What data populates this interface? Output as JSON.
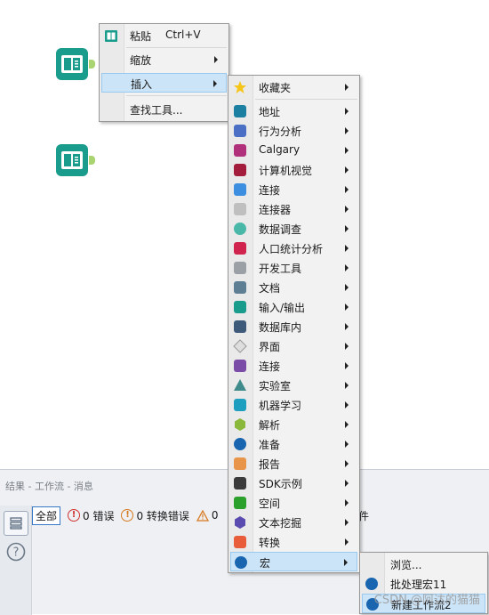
{
  "results": {
    "title": "结果 - 工作流 - 消息",
    "filter_all": "全部",
    "errors": "0 错误",
    "conversion_errors": "0 转换错误",
    "warnings_partial": "0",
    "trailing_char": "件"
  },
  "context_menu": {
    "paste": "粘贴",
    "paste_shortcut": "Ctrl+V",
    "zoom": "缩放",
    "insert": "插入",
    "find_tool": "查找工具..."
  },
  "insert_menu": {
    "items": [
      {
        "label": "收藏夹",
        "icon": "star-icon",
        "color": "#f5c518"
      },
      {
        "label": "地址",
        "icon": "address-icon",
        "color": "#1a7fa0"
      },
      {
        "label": "行为分析",
        "icon": "behavior-analysis-icon",
        "color": "#4a6fc4"
      },
      {
        "label": "Calgary",
        "icon": "calgary-icon",
        "color": "#b0307c"
      },
      {
        "label": "计算机视觉",
        "icon": "computer-vision-icon",
        "color": "#a31c3c"
      },
      {
        "label": "连接",
        "icon": "connector-icon",
        "color": "#3b8ee0"
      },
      {
        "label": "连接器",
        "icon": "connectors-icon",
        "color": "#bfbfbf"
      },
      {
        "label": "数据调查",
        "icon": "data-investigation-icon",
        "color": "#4ab8a8"
      },
      {
        "label": "人口统计分析",
        "icon": "demographic-analysis-icon",
        "color": "#d0244e"
      },
      {
        "label": "开发工具",
        "icon": "developer-icon",
        "color": "#9aa0a6"
      },
      {
        "label": "文档",
        "icon": "documentation-icon",
        "color": "#5e7e94"
      },
      {
        "label": "输入/输出",
        "icon": "in-out-icon",
        "color": "#1a9c8c"
      },
      {
        "label": "数据库内",
        "icon": "in-database-icon",
        "color": "#3d5a7a"
      },
      {
        "label": "界面",
        "icon": "interface-icon",
        "color": "#bdbdbd"
      },
      {
        "label": "连接",
        "icon": "join-icon",
        "color": "#7b4ba8"
      },
      {
        "label": "实验室",
        "icon": "laboratory-icon",
        "color": "#3f8a8a"
      },
      {
        "label": "机器学习",
        "icon": "machine-learning-icon",
        "color": "#1e9fc0"
      },
      {
        "label": "解析",
        "icon": "parse-icon",
        "color": "#8ab83a"
      },
      {
        "label": "准备",
        "icon": "preparation-icon",
        "color": "#1a65b0"
      },
      {
        "label": "报告",
        "icon": "reporting-icon",
        "color": "#e8954a"
      },
      {
        "label": "SDK示例",
        "icon": "sdk-icon",
        "color": "#3a3a3a"
      },
      {
        "label": "空间",
        "icon": "spatial-icon",
        "color": "#2ba12b"
      },
      {
        "label": "文本挖掘",
        "icon": "text-mining-icon",
        "color": "#5a4bb0"
      },
      {
        "label": "转换",
        "icon": "transform-icon",
        "color": "#e85c3a"
      },
      {
        "label": "宏",
        "icon": "macro-icon",
        "color": "#1a65b0"
      }
    ]
  },
  "macro_menu": {
    "browse": "浏览...",
    "batch_macro": "批处理宏11",
    "new_workflow": "新建工作流2"
  },
  "watermark": "CSDN @阿达的猫猫"
}
